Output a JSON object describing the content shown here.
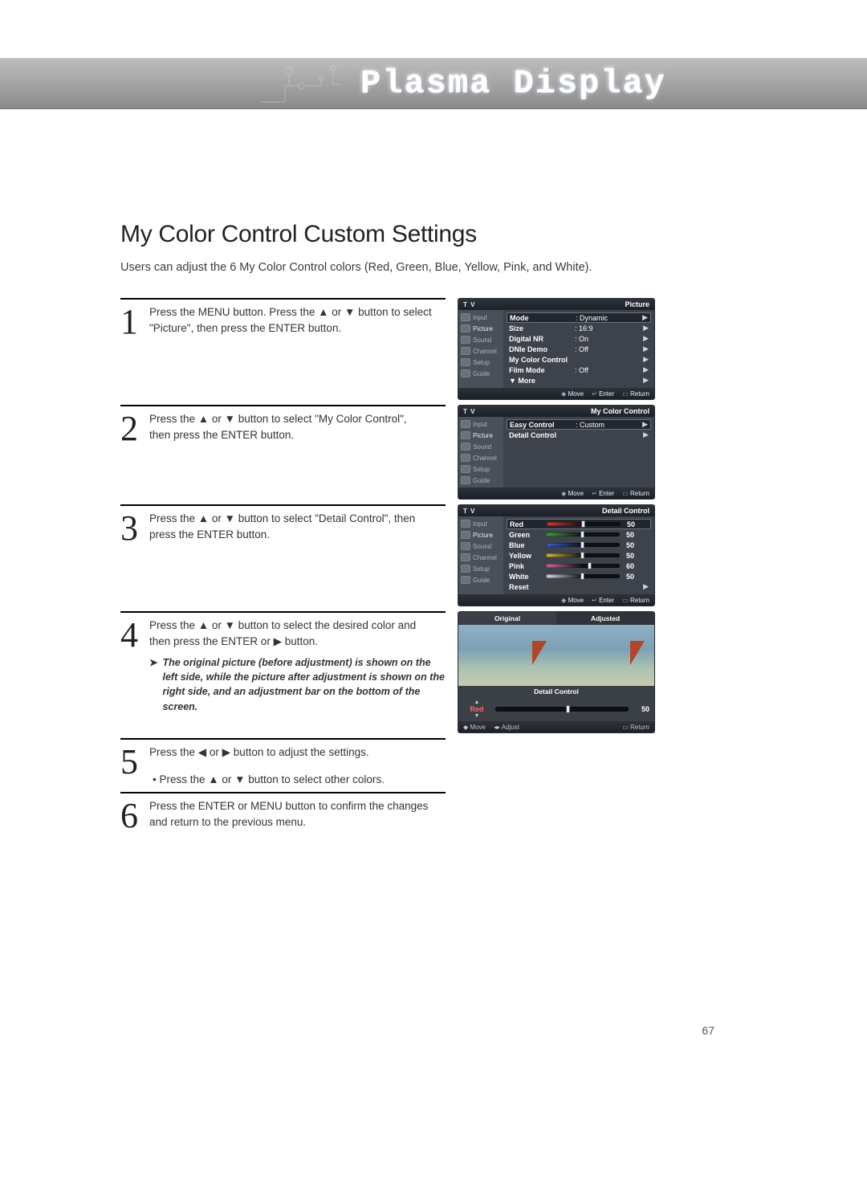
{
  "banner_title": "Plasma Display",
  "page_number": "67",
  "section_title": "My Color Control Custom Settings",
  "intro": "Users can adjust the 6 My Color Control colors (Red, Green, Blue, Yellow, Pink, and White).",
  "steps": {
    "s1": {
      "num": "1",
      "text_a": "Press the MENU button. Press the ▲ or ▼ button to select",
      "text_b": "\"Picture\", then press the ENTER button."
    },
    "s2": {
      "num": "2",
      "text_a": "Press the ▲ or ▼ button to select \"My Color Control\",",
      "text_b": "then press the ENTER button."
    },
    "s3": {
      "num": "3",
      "text_a": "Press the ▲ or ▼ button to select \"Detail Control\", then",
      "text_b": "press the ENTER button."
    },
    "s4": {
      "num": "4",
      "text_a": "Press the ▲ or ▼ button to select the desired color and",
      "text_b": "then press the ENTER or ▶ button.",
      "note": "The original picture (before adjustment) is shown on the left side, while the picture after adjustment is shown on the right side, and an adjustment bar on the bottom of the screen."
    },
    "s5": {
      "num": "5",
      "text_a": "Press the ◀ or ▶ button to adjust the settings.",
      "bullet": "• Press the ▲ or ▼ button to select other colors."
    },
    "s6": {
      "num": "6",
      "text_a": "Press the ENTER or MENU button to confirm the changes",
      "text_b": "and return to the previous menu."
    }
  },
  "osd_side": {
    "items": [
      "Input",
      "Picture",
      "Sound",
      "Channel",
      "Setup",
      "Guide"
    ]
  },
  "osd_foot": {
    "move": "Move",
    "enter": "Enter",
    "return": "Return",
    "adjust": "Adjust"
  },
  "osd1": {
    "tv": "T V",
    "title": "Picture",
    "rows": [
      {
        "label": "Mode",
        "val": ": Dynamic",
        "sel": true
      },
      {
        "label": "Size",
        "val": ": 16:9"
      },
      {
        "label": "Digital NR",
        "val": ": On"
      },
      {
        "label": "DNIe Demo",
        "val": ": Off"
      },
      {
        "label": "My Color Control",
        "val": ""
      },
      {
        "label": "Film Mode",
        "val": ": Off"
      },
      {
        "label": "▼ More",
        "val": ""
      }
    ]
  },
  "osd2": {
    "tv": "T V",
    "title": "My Color Control",
    "rows": [
      {
        "label": "Easy Control",
        "val": ": Custom",
        "sel": true
      },
      {
        "label": "Detail Control",
        "val": ""
      }
    ]
  },
  "osd3": {
    "tv": "T V",
    "title": "Detail Control",
    "rows": [
      {
        "label": "Red",
        "val": "50",
        "pos": 50,
        "c": "#e63a2e",
        "sel": true
      },
      {
        "label": "Green",
        "val": "50",
        "pos": 50,
        "c": "#3fae3f"
      },
      {
        "label": "Blue",
        "val": "50",
        "pos": 50,
        "c": "#3f63d6"
      },
      {
        "label": "Yellow",
        "val": "50",
        "pos": 50,
        "c": "#e6c23a"
      },
      {
        "label": "Pink",
        "val": "60",
        "pos": 60,
        "c": "#e66aa8"
      },
      {
        "label": "White",
        "val": "50",
        "pos": 50,
        "c": "#e8e8e8"
      },
      {
        "label": "Reset",
        "val": "",
        "noslider": true
      }
    ]
  },
  "osd4": {
    "tab_left": "Original",
    "tab_right": "Adjusted",
    "subtitle": "Detail Control",
    "label": "Red",
    "value": "50",
    "pos": 50
  },
  "note_arrow": "➤"
}
